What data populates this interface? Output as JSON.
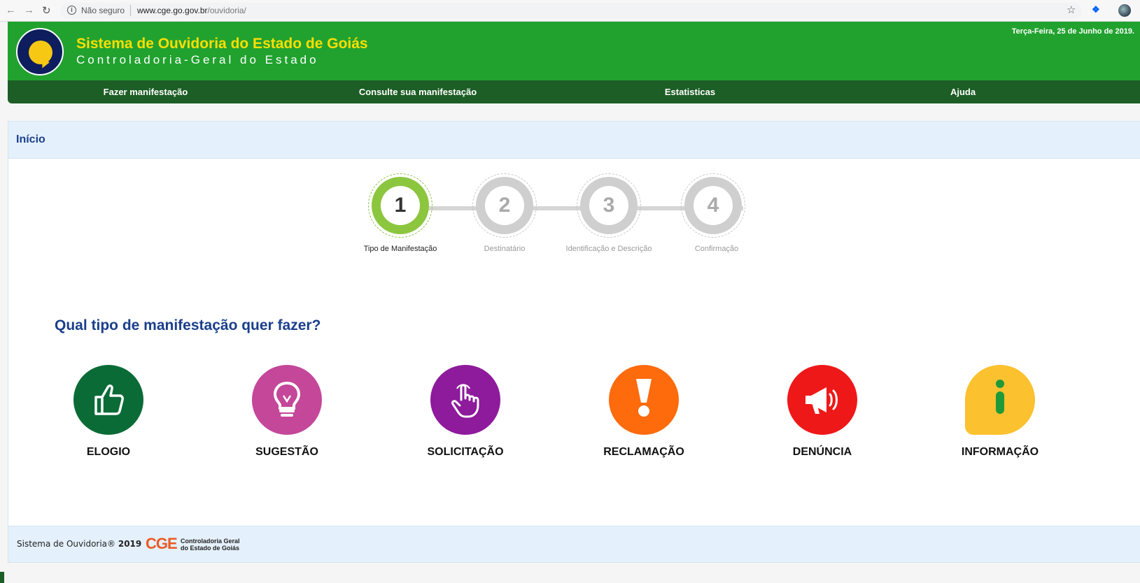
{
  "browser": {
    "security_label": "Não seguro",
    "url_host": "www.cge.go.gov.br",
    "url_path": "/ouvidoria/"
  },
  "header": {
    "title": "Sistema de Ouvidoria do Estado de Goiás",
    "subtitle": "Controladoria-Geral do Estado",
    "date": "Terça-Feira, 25 de Junho de 2019."
  },
  "menu": [
    {
      "label": "Fazer manifestação"
    },
    {
      "label": "Consulte sua manifestação"
    },
    {
      "label": "Estatisticas"
    },
    {
      "label": "Ajuda"
    }
  ],
  "breadcrumb": "Início",
  "steps": [
    {
      "number": "1",
      "label": "Tipo de Manifestação",
      "active": true
    },
    {
      "number": "2",
      "label": "Destinatário",
      "active": false
    },
    {
      "number": "3",
      "label": "Identificação e Descrição",
      "active": false
    },
    {
      "number": "4",
      "label": "Confirmação",
      "active": false
    }
  ],
  "question": "Qual tipo de manifestação quer fazer?",
  "options": [
    {
      "label": "ELOGIO",
      "icon": "thumbs-up-icon",
      "color": "#0b6b36"
    },
    {
      "label": "SUGESTÃO",
      "icon": "lightbulb-icon",
      "color": "#c4479a"
    },
    {
      "label": "SOLICITAÇÃO",
      "icon": "pointing-hand-icon",
      "color": "#8e1a9c"
    },
    {
      "label": "RECLAMAÇÃO",
      "icon": "exclamation-icon",
      "color": "#fd6b0c"
    },
    {
      "label": "DENÚNCIA",
      "icon": "megaphone-icon",
      "color": "#ef1818"
    },
    {
      "label": "INFORMAÇÃO",
      "icon": "info-bubble-icon",
      "color": "#fbc12f"
    }
  ],
  "footer": {
    "copyright": "Sistema de Ouvidoria®",
    "year": "2019",
    "brand": "CGE",
    "brand_line1": "Controladoria Geral",
    "brand_line2": "do Estado de Goiás"
  }
}
